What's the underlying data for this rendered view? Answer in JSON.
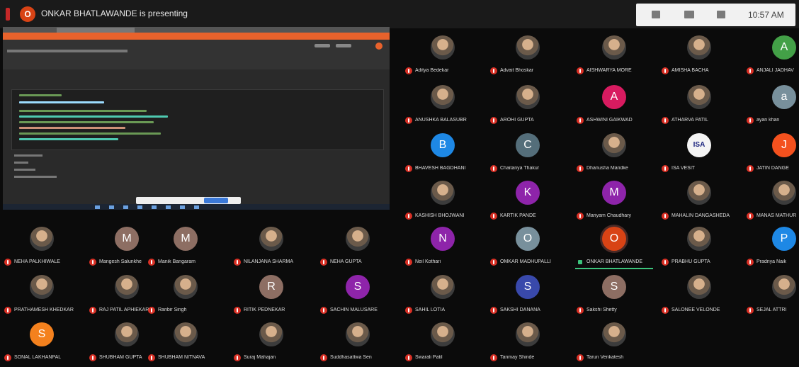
{
  "header": {
    "presenter_initial": "O",
    "presenting_text": "ONKAR BHATLAWANDE is presenting",
    "clock": "10:57 AM"
  },
  "colors": {
    "mute_red": "#d93025",
    "speaking_green": "#3cc47c",
    "presenter_orange": "#d84315"
  },
  "participants": [
    {
      "name": "Aditya Bedekar",
      "initial": "",
      "color": "",
      "muted": true
    },
    {
      "name": "Advait Bhoskar",
      "initial": "",
      "color": "",
      "muted": true
    },
    {
      "name": "AISHWARYA MORE",
      "initial": "",
      "color": "",
      "muted": true
    },
    {
      "name": "AMISHA BACHA",
      "initial": "",
      "color": "",
      "muted": true
    },
    {
      "name": "ANJALI JADHAV",
      "initial": "A",
      "color": "#43a047",
      "muted": true
    },
    {
      "name": "ANUSHKA BALASUBR",
      "initial": "",
      "color": "",
      "muted": true
    },
    {
      "name": "AROHI GUPTA",
      "initial": "",
      "color": "",
      "muted": true
    },
    {
      "name": "ASHWINI GAIKWAD",
      "initial": "A",
      "color": "#d81b60",
      "muted": true
    },
    {
      "name": "ATHARVA PATIL",
      "initial": "",
      "color": "",
      "muted": true
    },
    {
      "name": "ayan khan",
      "initial": "a",
      "color": "#78909c",
      "muted": true
    },
    {
      "name": "BHAVESH BAGDHANI",
      "initial": "B",
      "color": "#1e88e5",
      "muted": true
    },
    {
      "name": "Chaitanya Thakur",
      "initial": "C",
      "color": "#546e7a",
      "muted": true
    },
    {
      "name": "Dhanusha Mandke",
      "initial": "",
      "color": "",
      "muted": true
    },
    {
      "name": "ISA VESIT",
      "initial": "ISA",
      "color": "#f4f4f4",
      "muted": true
    },
    {
      "name": "JATIN DANGE",
      "initial": "J",
      "color": "#f4511e",
      "muted": true
    },
    {
      "name": "KASHISH BHOJWANI",
      "initial": "",
      "color": "",
      "muted": true
    },
    {
      "name": "KARTIK PANDE",
      "initial": "K",
      "color": "#8e24aa",
      "muted": true
    },
    {
      "name": "Mariyam Chaudhary",
      "initial": "M",
      "color": "#8e24aa",
      "muted": true
    },
    {
      "name": "MAHALIN DANGASHEDA",
      "initial": "",
      "color": "",
      "muted": true
    },
    {
      "name": "MANAS MATHUR",
      "initial": "",
      "color": "",
      "muted": true
    },
    {
      "name": "NEHA PALKHIWALE",
      "initial": "",
      "color": "",
      "muted": true
    },
    {
      "name": "Mangesh Salunkhe",
      "initial": "M",
      "color": "#8d6e63",
      "muted": true
    },
    {
      "name": "Manik Bangaram",
      "initial": "M",
      "color": "#8d6e63",
      "muted": true
    },
    {
      "name": "NILANJANA SHARMA",
      "initial": "",
      "color": "",
      "muted": true
    },
    {
      "name": "NEHA GUPTA",
      "initial": "",
      "color": "",
      "muted": true
    },
    {
      "name": "Neil Kothari",
      "initial": "N",
      "color": "#8e24aa",
      "muted": true
    },
    {
      "name": "OMKAR MADHUPALLI",
      "initial": "O",
      "color": "#78909c",
      "muted": true
    },
    {
      "name": "ONKAR BHATLAWANDE",
      "initial": "O",
      "color": "#d84315",
      "muted": false,
      "speaking": true
    },
    {
      "name": "PRABHU GUPTA",
      "initial": "",
      "color": "",
      "muted": true
    },
    {
      "name": "Pradnya Naik",
      "initial": "P",
      "color": "#1e88e5",
      "muted": true
    },
    {
      "name": "PRATHAMESH KHEDKAR",
      "initial": "",
      "color": "",
      "muted": true
    },
    {
      "name": "RAJ PATIL APHIEKAR",
      "initial": "",
      "color": "",
      "muted": true
    },
    {
      "name": "Ranbir Singh",
      "initial": "",
      "color": "",
      "muted": true
    },
    {
      "name": "RITIK PEDNEKAR",
      "initial": "R",
      "color": "#8d6e63",
      "muted": true
    },
    {
      "name": "SACHIN MALUSARE",
      "initial": "S",
      "color": "#8e24aa",
      "muted": true
    },
    {
      "name": "SAHIL LOTIA",
      "initial": "",
      "color": "",
      "muted": true
    },
    {
      "name": "SAKSHI DANANA",
      "initial": "S",
      "color": "#3949ab",
      "muted": true
    },
    {
      "name": "Sakshi Shetty",
      "initial": "S",
      "color": "#8d6e63",
      "muted": true
    },
    {
      "name": "SALONEE VELONDE",
      "initial": "",
      "color": "",
      "muted": true
    },
    {
      "name": "SEJAL ATTRI",
      "initial": "",
      "color": "",
      "muted": true
    },
    {
      "name": "SONAL LAKHANPAL",
      "initial": "S",
      "color": "#f4811e",
      "muted": true
    },
    {
      "name": "SHUBHAM GUPTA",
      "initial": "",
      "color": "",
      "muted": true
    },
    {
      "name": "SHUBHAM NITNAVA",
      "initial": "",
      "color": "",
      "muted": true
    },
    {
      "name": "Suraj Mahajan",
      "initial": "",
      "color": "",
      "muted": true
    },
    {
      "name": "Suddhasattwa Sen",
      "initial": "",
      "color": "",
      "muted": true
    },
    {
      "name": "Swarali Patil",
      "initial": "",
      "color": "",
      "muted": true
    },
    {
      "name": "Tanmay Shinde",
      "initial": "",
      "color": "",
      "muted": true
    },
    {
      "name": "Tarun Venkatesh",
      "initial": "",
      "color": "",
      "muted": true
    }
  ]
}
